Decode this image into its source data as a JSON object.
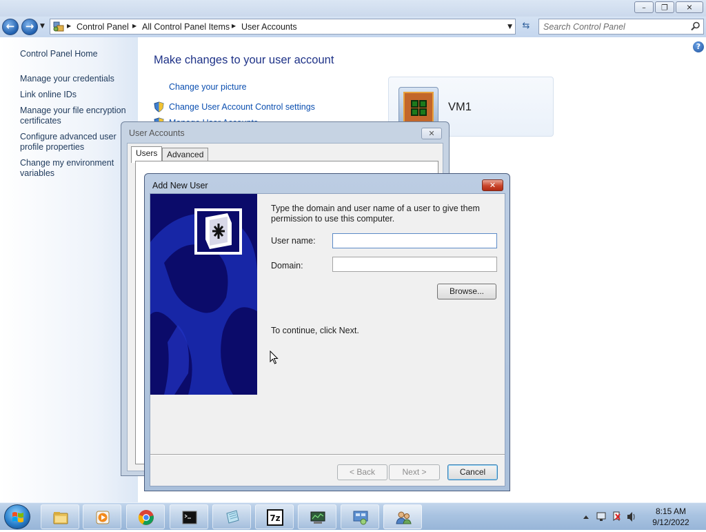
{
  "window": {
    "minimize_glyph": "–",
    "maximize_glyph": "❐",
    "close_glyph": "✕"
  },
  "address": {
    "crumbs": [
      "Control Panel",
      "All Control Panel Items",
      "User Accounts"
    ]
  },
  "search": {
    "placeholder": "Search Control Panel"
  },
  "sidebar": {
    "items": [
      {
        "label": "Control Panel Home"
      },
      {
        "label": "Manage your credentials"
      },
      {
        "label": "Link online IDs"
      },
      {
        "label": "Manage your file encryption certificates"
      },
      {
        "label": "Configure advanced user profile properties"
      },
      {
        "label": "Change my environment variables"
      }
    ]
  },
  "main": {
    "heading": "Make changes to your user account",
    "links": [
      {
        "label": "Change your picture"
      },
      {
        "label": "Change User Account Control settings"
      },
      {
        "label": "Manage User Accounts"
      }
    ],
    "user_name": "VM1"
  },
  "user_accounts_dialog": {
    "title": "User Accounts",
    "tabs": [
      {
        "label": "Users"
      },
      {
        "label": "Advanced"
      }
    ]
  },
  "add_user_dialog": {
    "title": "Add New User",
    "instructions": "Type the domain and user name of a user to give them permission to use this computer.",
    "username_label": "User name:",
    "username_value": "",
    "domain_label": "Domain:",
    "domain_value": "",
    "browse_label": "Browse...",
    "continue_text": "To continue, click Next.",
    "back_label": "< Back",
    "next_label": "Next >",
    "cancel_label": "Cancel"
  },
  "taskbar": {
    "time": "8:15 AM",
    "date": "9/12/2022"
  },
  "colors": {
    "link": "#0b4fb0",
    "heading": "#1e3287",
    "wizard_art": "#0b0b6a"
  }
}
